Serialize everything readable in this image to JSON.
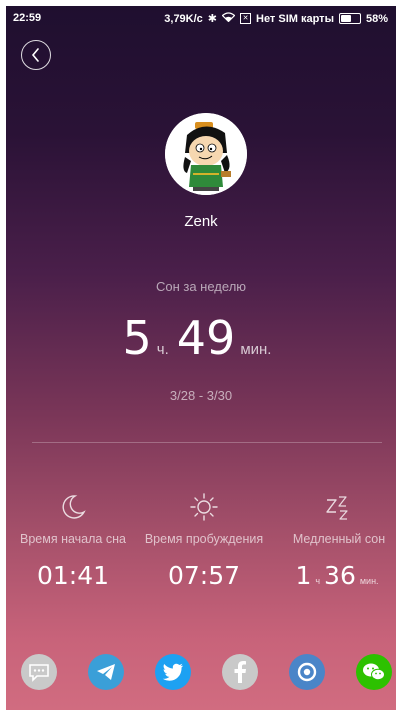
{
  "status_bar": {
    "time": "22:59",
    "speed": "3,79K/c",
    "sim_icon_label": "✕",
    "carrier": "Нет SIM карты",
    "battery": "58%"
  },
  "profile": {
    "name": "Zenk"
  },
  "summary": {
    "label": "Сон за неделю",
    "hours": "5",
    "hours_unit": "ч.",
    "minutes": "49",
    "minutes_unit": "мин.",
    "date_range": "3/28 - 3/30"
  },
  "stats": [
    {
      "icon": "moon-icon",
      "label": "Время начала сна",
      "value": "01:41"
    },
    {
      "icon": "sun-icon",
      "label": "Время пробуждения",
      "value": "07:57"
    },
    {
      "icon": "zzz-icon",
      "label": "Медленный сон",
      "hours": "1",
      "hours_unit": "ч",
      "minutes": "36",
      "minutes_unit": "мин."
    }
  ],
  "share": [
    {
      "icon": "chat-icon",
      "color": "#c9c9c9"
    },
    {
      "icon": "telegram-icon",
      "color": "#3a9fd8"
    },
    {
      "icon": "twitter-icon",
      "color": "#1da1f2"
    },
    {
      "icon": "facebook-icon",
      "color": "#c9c9c9"
    },
    {
      "icon": "camera-icon",
      "color": "#4a85c8"
    },
    {
      "icon": "wechat-icon",
      "color": "#2dc100"
    }
  ]
}
